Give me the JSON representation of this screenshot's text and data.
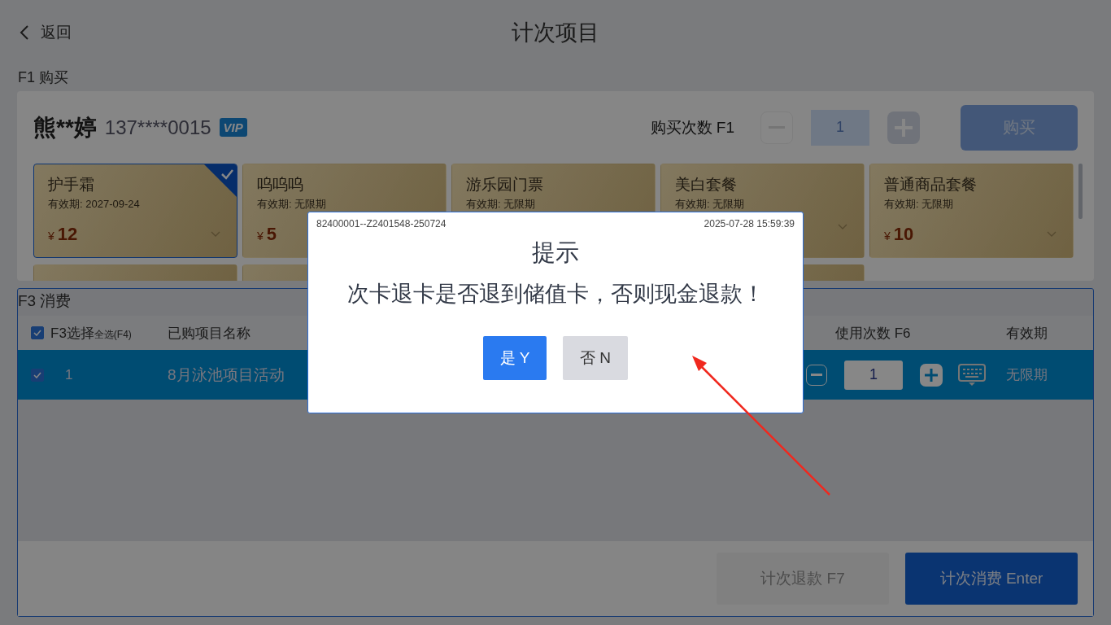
{
  "header": {
    "back": "返回",
    "title": "计次项目"
  },
  "purchase": {
    "section_label": "F1 购买",
    "customer_name": "熊**婷",
    "phone": "137****0015",
    "badge": "VIP",
    "quantity_label": "购买次数 F1",
    "quantity": "1",
    "buy_button": "购买",
    "cards": [
      {
        "name": "护手霜",
        "validity": "有效期: 2027-09-24",
        "currency": "¥",
        "price": "12",
        "selected": true,
        "dropdown": true
      },
      {
        "name": "呜呜呜",
        "validity": "有效期: 无限期",
        "currency": "¥",
        "price": "5",
        "selected": false
      },
      {
        "name": "游乐园门票",
        "validity": "有效期: 无限期",
        "selected": false
      },
      {
        "name": "美白套餐",
        "validity": "有效期: 无限期",
        "selected": false,
        "dropdown": true
      },
      {
        "name": "普通商品套餐",
        "validity": "有效期: 无限期",
        "currency": "¥",
        "price": "10",
        "selected": false,
        "dropdown": true
      }
    ],
    "next_row": [
      {
        "kind": "card"
      },
      {
        "kind": "card"
      },
      {
        "kind": "gap"
      },
      {
        "kind": "card"
      }
    ]
  },
  "consume": {
    "section_label": "F3 消费",
    "select_header": {
      "label": "F3选择",
      "hint": "全选(F4)",
      "checked": true
    },
    "columns": [
      "已购项目名称",
      "使用次数 F6",
      "有效期"
    ],
    "rows": [
      {
        "index": "1",
        "name": "8月泳池项目活动",
        "count": "1",
        "validity": "无限期",
        "checked": true,
        "selected": true
      }
    ],
    "refund_button": {
      "label": "计次退款 F7",
      "disabled": true
    },
    "consume_button": {
      "label": "计次消费 Enter",
      "disabled": false
    }
  },
  "dialog": {
    "serial": "82400001--Z2401548-250724",
    "time": "2025-07-28 15:59:39",
    "title": "提示",
    "message": "次卡退卡是否退到储值卡，否则现金退款！",
    "buttons": [
      {
        "label": "是 Y",
        "kind": "primary"
      },
      {
        "label": "否 N",
        "kind": "secondary"
      }
    ]
  }
}
